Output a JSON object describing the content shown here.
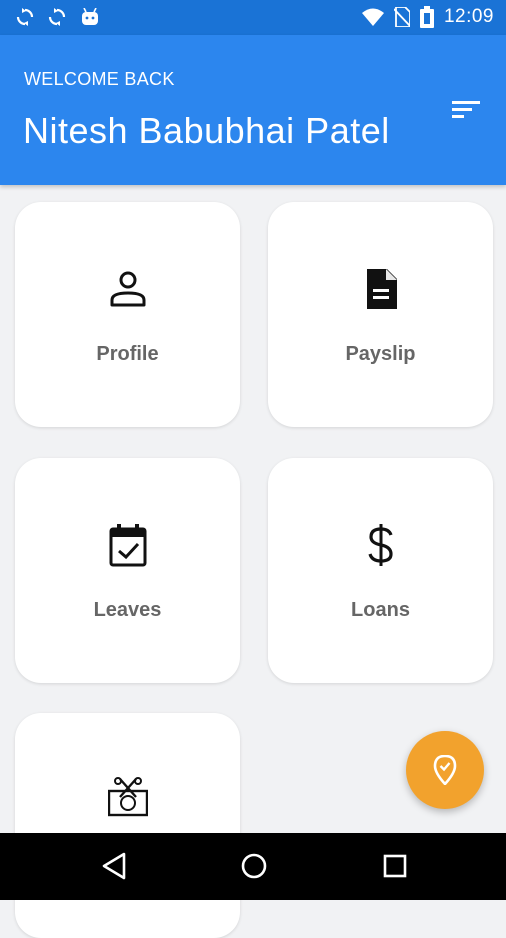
{
  "status_bar": {
    "time": "12:09",
    "icons": [
      "sync-icon",
      "sync-icon",
      "android-icon",
      "wifi-icon",
      "no-sim-icon",
      "battery-icon"
    ]
  },
  "header": {
    "greeting": "WELCOME BACK",
    "user_name": "Nitesh Babubhai Patel",
    "menu_icon": "sort-menu-icon",
    "background_color": "#2c86ee"
  },
  "tiles": [
    {
      "label": "Profile",
      "icon": "person-icon"
    },
    {
      "label": "Payslip",
      "icon": "document-icon"
    },
    {
      "label": "Leaves",
      "icon": "calendar-check-icon"
    },
    {
      "label": "Loans",
      "icon": "dollar-icon"
    },
    {
      "label": "",
      "icon": "cash-icon"
    }
  ],
  "fab": {
    "icon": "location-check-icon",
    "color": "#f2a22d"
  },
  "nav_bar": {
    "icons": [
      "back-icon",
      "home-icon",
      "recents-icon"
    ]
  }
}
